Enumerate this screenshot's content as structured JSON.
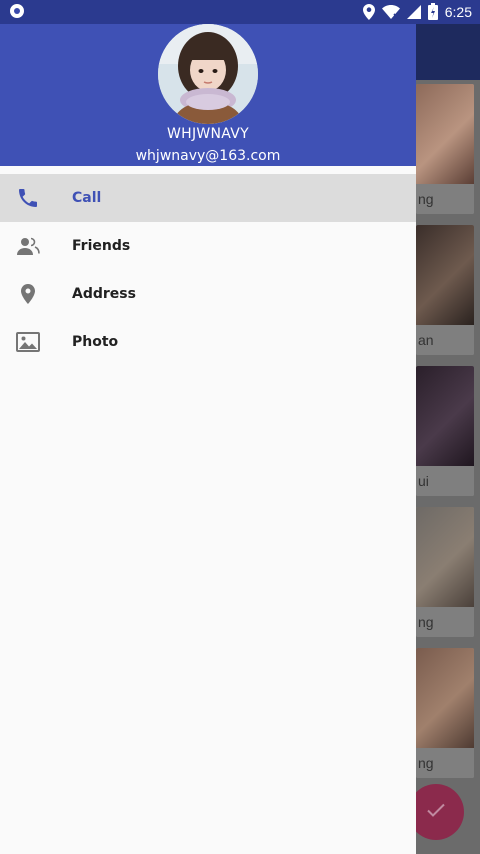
{
  "status_bar": {
    "time": "6:25",
    "icons": [
      "notification-circle-icon",
      "location-icon",
      "wifi-icon",
      "cell-signal-icon",
      "battery-icon"
    ]
  },
  "drawer": {
    "header": {
      "name": "WHJWNAVY",
      "email": "whjwnavy@163.com",
      "background_color": "#3f51b5"
    },
    "menu": [
      {
        "label": "Call",
        "icon": "phone-icon",
        "selected": true
      },
      {
        "label": "Friends",
        "icon": "friends-icon",
        "selected": false
      },
      {
        "label": "Address",
        "icon": "location-pin-icon",
        "selected": false
      },
      {
        "label": "Photo",
        "icon": "photo-icon",
        "selected": false
      }
    ]
  },
  "background": {
    "cards": [
      {
        "caption": "ng"
      },
      {
        "caption": "an"
      },
      {
        "caption": "ui"
      },
      {
        "caption": "ng"
      },
      {
        "caption": "ng"
      }
    ],
    "fab_icon": "check-icon"
  },
  "colors": {
    "primary": "#3f51b5",
    "status_bar": "#2b3a8f",
    "accent": "#e91e63",
    "selected_item_bg": "#dcdcdc"
  }
}
